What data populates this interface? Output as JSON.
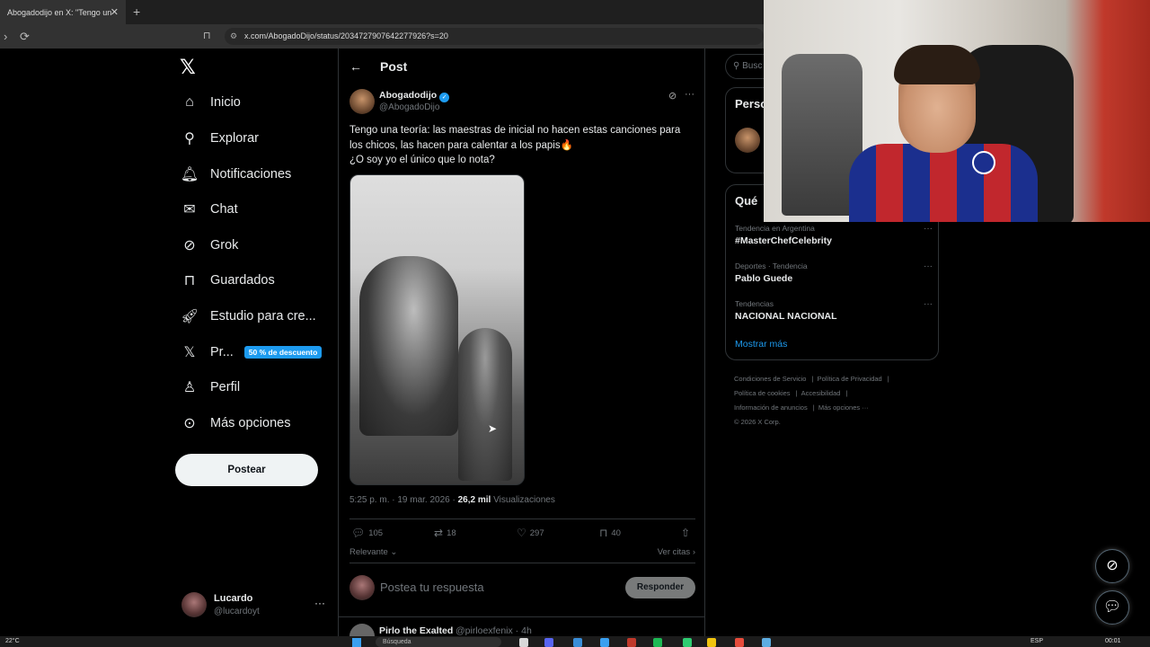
{
  "browser": {
    "tab_title": "Abogadodijo en X: \"Tengo un",
    "tab_close": "✕",
    "new_tab": "+",
    "url": "x.com/AbogadoDijo/status/2034727907642277926?s=20"
  },
  "nav": {
    "logo": "𝕏",
    "items": [
      {
        "label": "Inicio",
        "icon": "home-icon"
      },
      {
        "label": "Explorar",
        "icon": "search-icon"
      },
      {
        "label": "Notificaciones",
        "icon": "bell-icon"
      },
      {
        "label": "Chat",
        "icon": "mail-icon"
      },
      {
        "label": "Grok",
        "icon": "grok-icon"
      },
      {
        "label": "Guardados",
        "icon": "bookmark-icon"
      },
      {
        "label": "Estudio para cre...",
        "icon": "rocket-icon"
      },
      {
        "label": "Pr...",
        "icon": "x-premium-icon"
      },
      {
        "label": "Perfil",
        "icon": "person-icon"
      },
      {
        "label": "Más opciones",
        "icon": "more-circle-icon"
      }
    ],
    "promo_badge": "50 % de descuento",
    "post_button": "Postear",
    "me_name": "Lucardo",
    "me_handle": "@lucardoyt",
    "me_more": "···"
  },
  "post": {
    "header_title": "Post",
    "author_name": "Abogadodijo",
    "author_handle": "@AbogadoDijo",
    "text_line1": "Tengo una teoría: las maestras de inicial no hacen estas canciones para los chicos, las hacen para calentar a los papis🔥",
    "text_line2": "¿O soy yo el único que lo nota?",
    "time": "5:25 p. m. · 19 mar. 2026 · ",
    "views_count": "26,2 mil",
    "views_label": " Visualizaciones",
    "replies": "105",
    "reposts": "18",
    "likes": "297",
    "bookmarks": "40",
    "sort_label": "Relevante",
    "quotes_label": "Ver citas",
    "reply_placeholder": "Postea tu respuesta",
    "reply_button": "Responder",
    "next_name": "Pirlo the Exalted",
    "next_handle": "@pirloexfenix · 4h"
  },
  "sidebar": {
    "search_placeholder": "Busc",
    "card1_title": "Perso",
    "card2_title": "Qué",
    "trends": [
      {
        "category": "Tendencia en Argentina",
        "name": "#MasterChefCelebrity"
      },
      {
        "category": "Deportes · Tendencia",
        "name": "Pablo Guede"
      },
      {
        "category": "Tendencias",
        "name": "NACIONAL NACIONAL"
      }
    ],
    "trend_more": "···",
    "show_more": "Mostrar más",
    "footer": {
      "l1a": "Condiciones de Servicio",
      "l1b": "Política de Privacidad",
      "l2a": "Política de cookies",
      "l2b": "Accesibilidad",
      "l3a": "Información de anuncios",
      "l3b": "Más opciones ···",
      "copyright": "© 2026 X Corp."
    }
  },
  "taskbar": {
    "temperature": "22°C",
    "search": "Búsqueda",
    "lang": "ESP",
    "time": "00:01"
  }
}
